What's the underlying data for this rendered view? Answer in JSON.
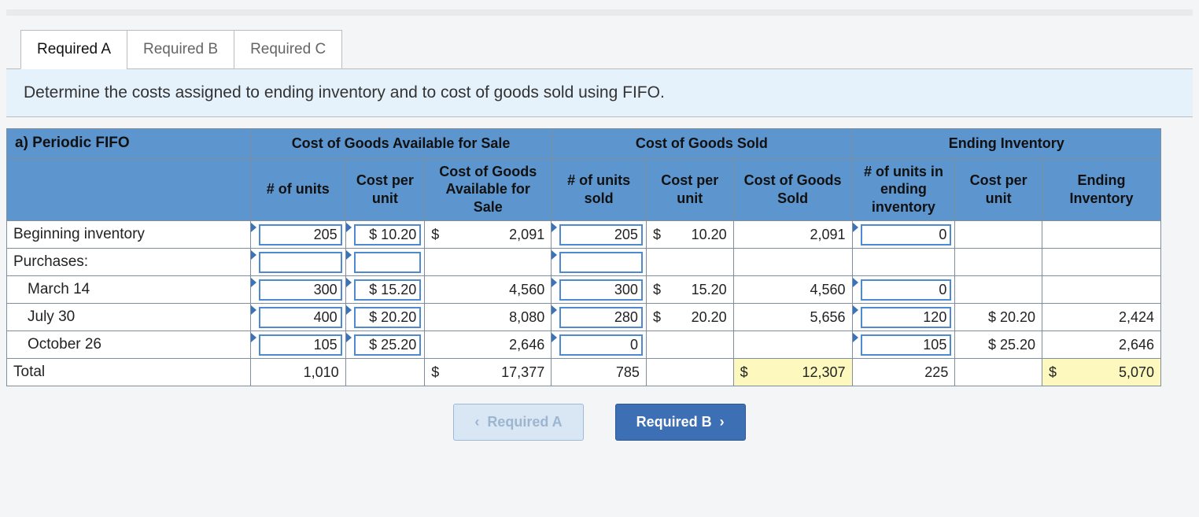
{
  "tabs": {
    "a": "Required A",
    "b": "Required B",
    "c": "Required C",
    "active": "a"
  },
  "instruction": "Determine the costs assigned to ending inventory and to cost of goods sold using FIFO.",
  "table": {
    "title": "a) Periodic FIFO",
    "groupHeaders": {
      "avail": "Cost of Goods Available for Sale",
      "cogs": "Cost of Goods Sold",
      "ending": "Ending Inventory"
    },
    "colHeaders": {
      "units_avail": "# of units",
      "cpu_avail": "Cost per unit",
      "cogas": "Cost of Goods Available for Sale",
      "units_sold": "# of units sold",
      "cpu_sold": "Cost per unit",
      "cogs": "Cost of Goods Sold",
      "units_end": "# of units in ending inventory",
      "cpu_end": "Cost per unit",
      "ending": "Ending Inventory"
    },
    "rows": {
      "begin": {
        "label": "Beginning inventory",
        "units_avail": "205",
        "cpu_avail": "$ 10.20",
        "cogas_sym": "$",
        "cogas": "2,091",
        "units_sold": "205",
        "cpu_sold_sym": "$",
        "cpu_sold": "10.20",
        "cogs": "2,091",
        "units_end": "0",
        "cpu_end": "",
        "ending": ""
      },
      "purchases_label": "Purchases:",
      "mar14": {
        "label": "March 14",
        "units_avail": "300",
        "cpu_avail": "$ 15.20",
        "cogas": "4,560",
        "units_sold": "300",
        "cpu_sold_sym": "$",
        "cpu_sold": "15.20",
        "cogs": "4,560",
        "units_end": "0",
        "cpu_end": "",
        "ending": ""
      },
      "jul30": {
        "label": "July 30",
        "units_avail": "400",
        "cpu_avail": "$ 20.20",
        "cogas": "8,080",
        "units_sold": "280",
        "cpu_sold_sym": "$",
        "cpu_sold": "20.20",
        "cogs": "5,656",
        "units_end": "120",
        "cpu_end": "$ 20.20",
        "ending": "2,424"
      },
      "oct26": {
        "label": "October 26",
        "units_avail": "105",
        "cpu_avail": "$ 25.20",
        "cogas": "2,646",
        "units_sold": "0",
        "cpu_sold": "",
        "cogs": "",
        "units_end": "105",
        "cpu_end": "$ 25.20",
        "ending": "2,646"
      },
      "total": {
        "label": "Total",
        "units_avail": "1,010",
        "cogas_sym": "$",
        "cogas": "17,377",
        "units_sold": "785",
        "cogs_sym": "$",
        "cogs": "12,307",
        "units_end": "225",
        "ending_sym": "$",
        "ending": "5,070"
      }
    }
  },
  "nav": {
    "prev": "Required A",
    "next": "Required B"
  },
  "chart_data": {
    "type": "table",
    "title": "a) Periodic FIFO — Cost of Goods Available, COGS, Ending Inventory",
    "columns": [
      "Row",
      "# of units",
      "Cost per unit",
      "Cost of Goods Available for Sale",
      "# of units sold",
      "Cost per unit (sold)",
      "Cost of Goods Sold",
      "# of units in ending inventory",
      "Cost per unit (ending)",
      "Ending Inventory"
    ],
    "rows": [
      [
        "Beginning inventory",
        205,
        10.2,
        2091,
        205,
        10.2,
        2091,
        0,
        null,
        null
      ],
      [
        "March 14",
        300,
        15.2,
        4560,
        300,
        15.2,
        4560,
        0,
        null,
        null
      ],
      [
        "July 30",
        400,
        20.2,
        8080,
        280,
        20.2,
        5656,
        120,
        20.2,
        2424
      ],
      [
        "October 26",
        105,
        25.2,
        2646,
        0,
        null,
        null,
        105,
        25.2,
        2646
      ],
      [
        "Total",
        1010,
        null,
        17377,
        785,
        null,
        12307,
        225,
        null,
        5070
      ]
    ]
  }
}
